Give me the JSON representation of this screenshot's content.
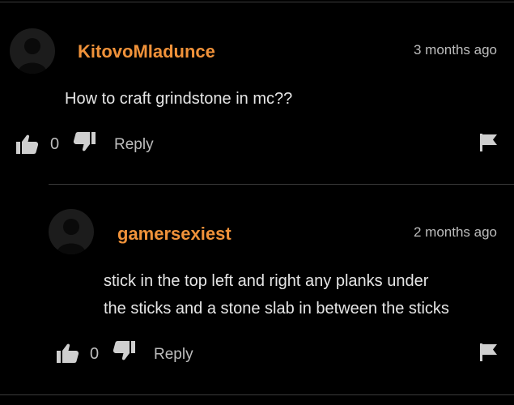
{
  "comments": [
    {
      "username": "KitovoMladunce",
      "timestamp": "3 months ago",
      "text_lines": [
        "How to craft grindstone in mc??"
      ],
      "likes": "0",
      "reply_label": "Reply",
      "avatar_icon": "avatar-icon"
    },
    {
      "username": "gamersexiest",
      "timestamp": "2 months ago",
      "text_lines": [
        "stick in the top left and right any planks under",
        "the sticks and a stone slab in between the sticks"
      ],
      "likes": "0",
      "reply_label": "Reply",
      "avatar_icon": "avatar-icon"
    }
  ],
  "colors": {
    "background": "#000000",
    "username": "#f0923a",
    "text": "#e6e6e6",
    "muted": "#bdbdbd"
  }
}
